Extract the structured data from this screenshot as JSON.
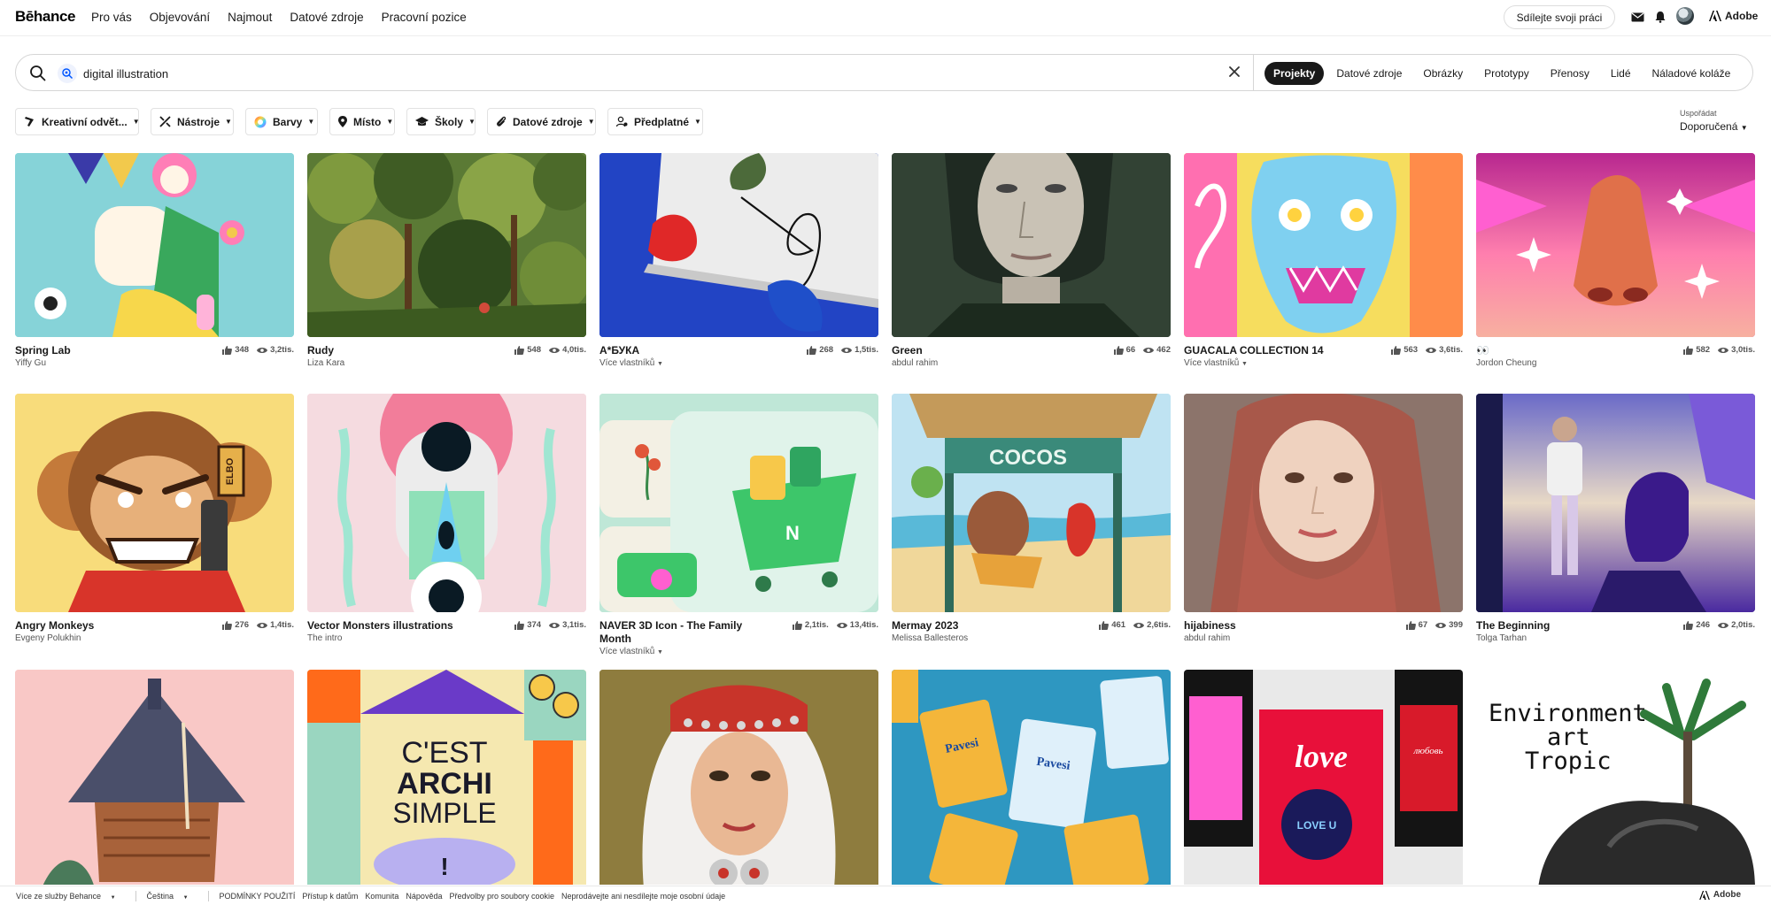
{
  "nav": {
    "logo": "Bēhance",
    "links": [
      "Pro vás",
      "Objevování",
      "Najmout",
      "Datové zdroje",
      "Pracovní pozice"
    ],
    "share_button": "Sdílejte svoji práci",
    "adobe": "Adobe"
  },
  "search": {
    "query": "digital illustration",
    "scopes": [
      "Projekty",
      "Datové zdroje",
      "Obrázky",
      "Prototypy",
      "Přenosy",
      "Lidé",
      "Náladové koláže"
    ],
    "active_scope": "Projekty"
  },
  "filters": [
    "Kreativní odvět...",
    "Nástroje",
    "Barvy",
    "Místo",
    "Školy",
    "Datové zdroje",
    "Předplatné"
  ],
  "sort": {
    "label": "Uspořádat",
    "value": "Doporučená"
  },
  "projects": [
    {
      "title": "Spring Lab",
      "owner": "Yiffy Gu",
      "likes": "348",
      "views": "3,2tis."
    },
    {
      "title": "Rudy",
      "owner": "Liza Kara",
      "likes": "548",
      "views": "4,0tis."
    },
    {
      "title": "А*БУКА",
      "owner": "Více vlastníků",
      "likes": "268",
      "views": "1,5tis."
    },
    {
      "title": "Green",
      "owner": "abdul rahim",
      "likes": "66",
      "views": "462"
    },
    {
      "title": "GUACALA COLLECTION 14",
      "owner": "Více vlastníků",
      "likes": "563",
      "views": "3,6tis."
    },
    {
      "title": "👀",
      "owner": "Jordon Cheung",
      "likes": "582",
      "views": "3,0tis."
    },
    {
      "title": "Angry Monkeys",
      "owner": "Evgeny Polukhin",
      "likes": "276",
      "views": "1,4tis."
    },
    {
      "title": "Vector Monsters illustrations",
      "owner": "The intro",
      "likes": "374",
      "views": "3,1tis."
    },
    {
      "title": "NAVER 3D Icon - The Family Month",
      "owner": "Více vlastníků",
      "likes": "2,1tis.",
      "views": "13,4tis."
    },
    {
      "title": "Mermay 2023",
      "owner": "Melissa Ballesteros",
      "likes": "461",
      "views": "2,6tis."
    },
    {
      "title": "hijabiness",
      "owner": "abdul rahim",
      "likes": "67",
      "views": "399"
    },
    {
      "title": "The Beginning",
      "owner": "Tolga Tarhan",
      "likes": "246",
      "views": "2,0tis."
    }
  ],
  "thumb_text": {
    "archi_1": "C'EST",
    "archi_2": "ARCHI",
    "archi_3": "SIMPLE",
    "archi_4": "!",
    "env_1": "Environment",
    "env_2": "art",
    "env_3": "Tropic",
    "cocos": "COCOS",
    "naver_n": "N",
    "love": "love",
    "love_u": "LOVE U",
    "love_ru": "любовь",
    "pavesi": "Pavesi",
    "elbo": "ELBO"
  },
  "footer": {
    "items": [
      "Více ze služby Behance",
      "Čeština",
      "PODMÍNKY POUŽITÍ",
      "Přístup k datům",
      "Komunita",
      "Nápověda",
      "Předvolby pro soubory cookie",
      "Neprodávejte ani nesdílejte moje osobní údaje"
    ],
    "adobe": "Adobe"
  },
  "colors": {
    "accent": "#191919",
    "active_scope_bg": "#191919",
    "link_blue": "#0057ff"
  }
}
